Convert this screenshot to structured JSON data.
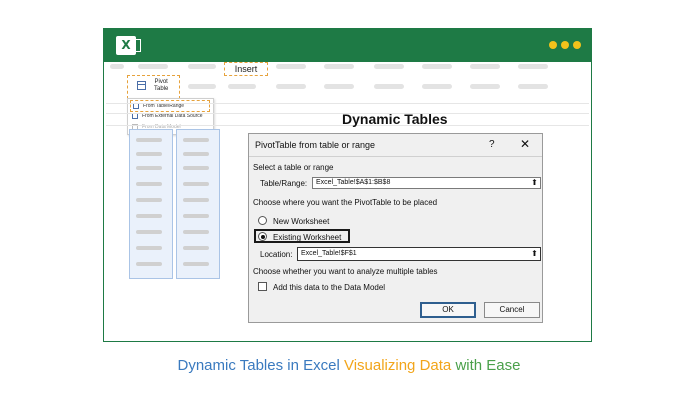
{
  "app": {
    "logo_letter": "X"
  },
  "ribbon": {
    "insert_tab": "Insert",
    "pivot_button_label_1": "Pivot",
    "pivot_button_label_2": "Table"
  },
  "dropdown": {
    "items": [
      {
        "label": "From Table/Range",
        "selected": true,
        "disabled": false
      },
      {
        "label": "From External Data Source",
        "selected": false,
        "disabled": false
      },
      {
        "label": "From Data Model",
        "selected": false,
        "disabled": true
      }
    ]
  },
  "heading": "Dynamic Tables",
  "dialog": {
    "title": "PivotTable from table or range",
    "help_label": "?",
    "close_label": "✕",
    "select_label": "Select a table or range",
    "table_range_label": "Table/Range:",
    "table_range_value": "Excel_Table!$A$1:$B$8",
    "placement_label": "Choose where you want the PivotTable to be placed",
    "new_worksheet_label": "New Worksheet",
    "existing_worksheet_label": "Existing Worksheet",
    "location_label": "Location:",
    "location_value": "Excel_Table!$F$1",
    "multiple_tables_label": "Choose whether you want to analyze multiple tables",
    "data_model_label": "Add this data to the Data Model",
    "data_model_checked": false,
    "selected_option": "existing",
    "ok_label": "OK",
    "cancel_label": "Cancel",
    "collapse_icon": "⬆"
  },
  "caption": {
    "part1": "Dynamic Tables in Excel",
    "part2": "Visualizing Data",
    "part3": "with Ease"
  },
  "colors": {
    "titlebar": "#1e7a45",
    "dots": "#f2c21b",
    "caption_blue": "#3a7abf",
    "caption_orange": "#f2a51a",
    "caption_green": "#4aa04a"
  }
}
